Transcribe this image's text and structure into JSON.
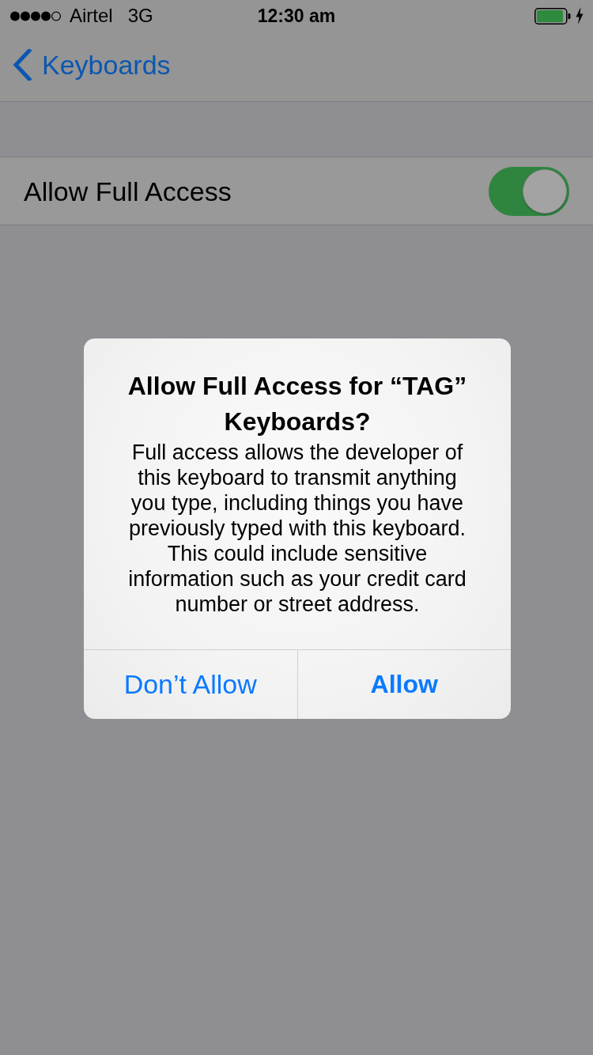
{
  "status_bar": {
    "carrier": "Airtel",
    "network": "3G",
    "time": "12:30 am"
  },
  "nav_bar": {
    "back_label": "Keyboards"
  },
  "settings": [
    {
      "label": "Allow Full Access",
      "on": true
    }
  ],
  "alert": {
    "title": "Allow Full Access for “TAG” Keyboards?",
    "message": "Full access allows the developer of this keyboard to transmit anything you type, including things you have previously typed with this keyboard. This could include sensitive information such as your credit card number or street address.",
    "buttons": [
      {
        "label": "Don’t Allow",
        "kind": "cancel"
      },
      {
        "label": "Allow",
        "kind": "default"
      }
    ]
  }
}
